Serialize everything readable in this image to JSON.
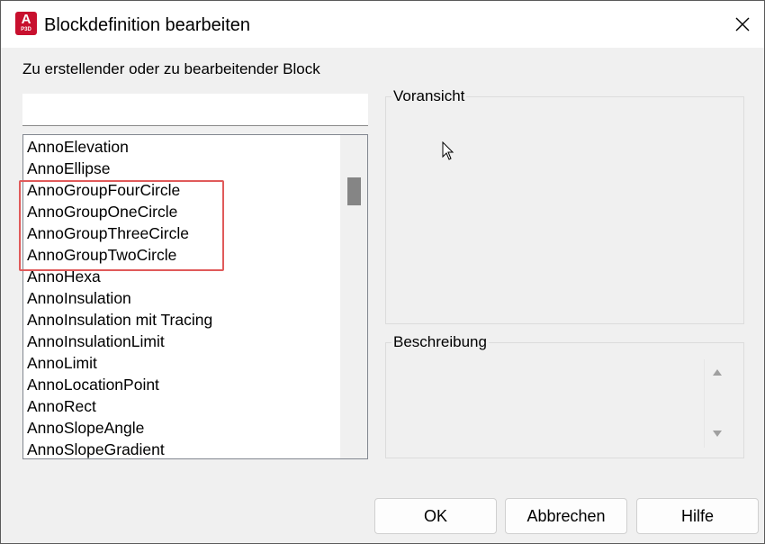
{
  "window": {
    "title": "Blockdefinition bearbeiten",
    "app_icon_letter": "A",
    "app_icon_sub": "P3D"
  },
  "block_section": {
    "label": "Zu erstellender oder zu bearbeitender Block",
    "name_value": "",
    "items": [
      "AnnoElevation",
      "AnnoEllipse",
      "AnnoGroupFourCircle",
      "AnnoGroupOneCircle",
      "AnnoGroupThreeCircle",
      "AnnoGroupTwoCircle",
      "AnnoHexa",
      "AnnoInsulation",
      "AnnoInsulation mit Tracing",
      "AnnoInsulationLimit",
      "AnnoLimit",
      "AnnoLocationPoint",
      "AnnoRect",
      "AnnoSlopeAngle",
      "AnnoSlopeGradient"
    ]
  },
  "preview": {
    "label": "Voransicht"
  },
  "description": {
    "label": "Beschreibung"
  },
  "buttons": {
    "ok": "OK",
    "cancel": "Abbrechen",
    "help": "Hilfe"
  },
  "colors": {
    "app_icon": "#c8102e",
    "highlight_border": "#e05a5a",
    "scroll_thumb": "#858585"
  }
}
